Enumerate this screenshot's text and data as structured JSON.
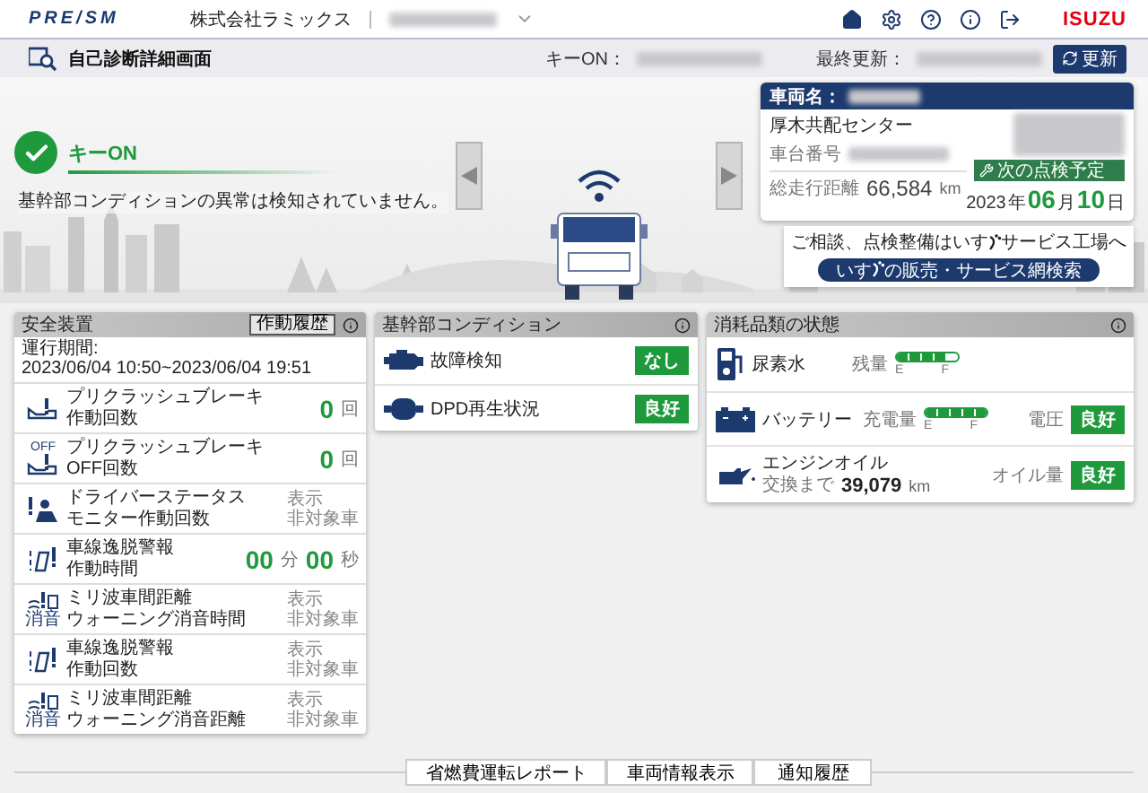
{
  "header": {
    "logo": "PRE/SM",
    "company": "株式会社ラミックス",
    "brand": "ISUZU"
  },
  "subheader": {
    "title": "自己診断詳細画面",
    "key_on_label": "キーON：",
    "last_update_label": "最終更新：",
    "refresh_button": "更新"
  },
  "status": {
    "label": "キーON",
    "message": "基幹部コンディションの異常は検知されていません。"
  },
  "vehicle": {
    "name_label": "車両名：",
    "depot": "厚木共配センター",
    "chassis_label": "車台番号",
    "mileage_label": "総走行距離",
    "mileage": "66,584",
    "mileage_unit": "km",
    "next_inspection_label": "次の点検予定",
    "year": "2023",
    "year_unit": "年",
    "month": "06",
    "month_unit": "月",
    "day": "10",
    "day_unit": "日"
  },
  "dealer_notice": {
    "text_parts": [
      "ご相談、点検整備はいす",
      "サービス工場へ"
    ],
    "button_parts": [
      "いす",
      "の販売・サービス網検索"
    ]
  },
  "safety": {
    "title": "安全装置",
    "history_button": "作動履歴",
    "period_label": "運行期間:",
    "period": "2023/06/04 10:50~2023/06/04 19:51",
    "rows": [
      {
        "label": "プリクラッシュブレーキ",
        "sub": "作動回数",
        "kind": "count",
        "value": "0",
        "unit": "回"
      },
      {
        "icon_label": "OFF",
        "label": "プリクラッシュブレーキ",
        "sub": "OFF回数",
        "kind": "count",
        "value": "0",
        "unit": "回"
      },
      {
        "label": "ドライバーステータス",
        "sub": "モニター作動回数",
        "kind": "na",
        "line1": "表示",
        "line2": "非対象車"
      },
      {
        "label": "車線逸脱警報",
        "sub": "作動時間",
        "kind": "time",
        "minutes": "00",
        "minutes_unit": "分",
        "seconds": "00",
        "seconds_unit": "秒"
      },
      {
        "icon_label": "消音",
        "label": "ミリ波車間距離",
        "sub": "ウォーニング消音時間",
        "kind": "na",
        "line1": "表示",
        "line2": "非対象車"
      },
      {
        "label": "車線逸脱警報",
        "sub": "作動回数",
        "kind": "na",
        "line1": "表示",
        "line2": "非対象車"
      },
      {
        "icon_label": "消音",
        "label": "ミリ波車間距離",
        "sub": "ウォーニング消音距離",
        "kind": "na",
        "line1": "表示",
        "line2": "非対象車"
      }
    ]
  },
  "condition": {
    "title": "基幹部コンディション",
    "rows": [
      {
        "label": "故障検知",
        "badge": "なし"
      },
      {
        "label": "DPD再生状況",
        "badge": "良好"
      }
    ]
  },
  "consumables": {
    "title": "消耗品類の状態",
    "rows": [
      {
        "kind": "gauge",
        "label": "尿素水",
        "gauge_label": "残量",
        "level": 0.8,
        "empty": "E",
        "full": "F"
      },
      {
        "kind": "gauge",
        "label": "バッテリー",
        "gauge_label": "充電量",
        "level": 1.0,
        "empty": "E",
        "full": "F",
        "status_label": "電圧",
        "badge": "良好"
      },
      {
        "kind": "distance",
        "label": "エンジンオイル",
        "distance_label": "交換まで",
        "distance": "39,079",
        "distance_unit": "km",
        "status_label": "オイル量",
        "badge": "良好"
      }
    ]
  },
  "footer_buttons": [
    "省燃費運転レポート",
    "車両情報表示",
    "通知履歴"
  ]
}
